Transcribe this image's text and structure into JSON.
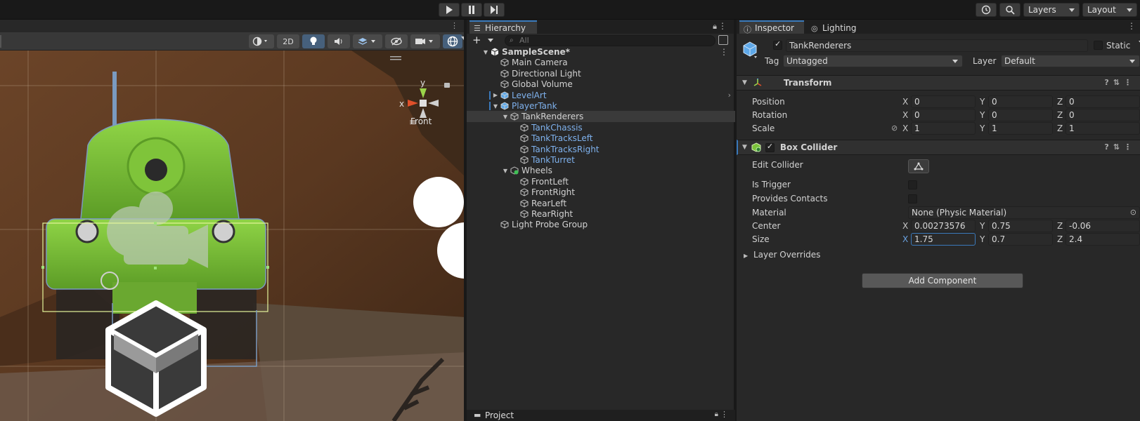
{
  "toolbar": {
    "layers_label": "Layers",
    "layout_label": "Layout"
  },
  "scene": {
    "mode_2d": "2D",
    "view_label": "Front",
    "axis_y": "y",
    "axis_x": "x"
  },
  "hierarchy": {
    "tab_label": "Hierarchy",
    "search_placeholder": "All",
    "items": [
      {
        "label": "SampleScene*",
        "indent": 0,
        "fold": "open",
        "kind": "scene",
        "blue": false,
        "selected": false
      },
      {
        "label": "Main Camera",
        "indent": 1,
        "fold": "none",
        "kind": "cube",
        "blue": false,
        "selected": false
      },
      {
        "label": "Directional Light",
        "indent": 1,
        "fold": "none",
        "kind": "cube",
        "blue": false,
        "selected": false
      },
      {
        "label": "Global Volume",
        "indent": 1,
        "fold": "none",
        "kind": "cube",
        "blue": false,
        "selected": false
      },
      {
        "label": "LevelArt",
        "indent": 1,
        "fold": "closed",
        "kind": "prefab",
        "blue": true,
        "selected": false
      },
      {
        "label": "PlayerTank",
        "indent": 1,
        "fold": "open",
        "kind": "prefab",
        "blue": true,
        "selected": false
      },
      {
        "label": "TankRenderers",
        "indent": 2,
        "fold": "open",
        "kind": "cube",
        "blue": false,
        "selected": true
      },
      {
        "label": "TankChassis",
        "indent": 3,
        "fold": "none",
        "kind": "cube",
        "blue": true,
        "selected": false
      },
      {
        "label": "TankTracksLeft",
        "indent": 3,
        "fold": "none",
        "kind": "cube",
        "blue": true,
        "selected": false
      },
      {
        "label": "TankTracksRight",
        "indent": 3,
        "fold": "none",
        "kind": "cube",
        "blue": true,
        "selected": false
      },
      {
        "label": "TankTurret",
        "indent": 3,
        "fold": "none",
        "kind": "cube",
        "blue": true,
        "selected": false
      },
      {
        "label": "Wheels",
        "indent": 2,
        "fold": "open",
        "kind": "gear",
        "blue": false,
        "selected": false
      },
      {
        "label": "FrontLeft",
        "indent": 3,
        "fold": "none",
        "kind": "cube",
        "blue": false,
        "selected": false
      },
      {
        "label": "FrontRight",
        "indent": 3,
        "fold": "none",
        "kind": "cube",
        "blue": false,
        "selected": false
      },
      {
        "label": "RearLeft",
        "indent": 3,
        "fold": "none",
        "kind": "cube",
        "blue": false,
        "selected": false
      },
      {
        "label": "RearRight",
        "indent": 3,
        "fold": "none",
        "kind": "cube",
        "blue": false,
        "selected": false
      },
      {
        "label": "Light Probe Group",
        "indent": 1,
        "fold": "none",
        "kind": "cube",
        "blue": false,
        "selected": false
      }
    ]
  },
  "project": {
    "tab_label": "Project"
  },
  "inspector": {
    "tab_label": "Inspector",
    "lighting_tab_label": "Lighting",
    "object_name": "TankRenderers",
    "static_label": "Static",
    "tag_label": "Tag",
    "tag_value": "Untagged",
    "layer_label": "Layer",
    "layer_value": "Default",
    "transform": {
      "title": "Transform",
      "position_label": "Position",
      "rotation_label": "Rotation",
      "scale_label": "Scale",
      "position": {
        "x": "0",
        "y": "0",
        "z": "0"
      },
      "rotation": {
        "x": "0",
        "y": "0",
        "z": "0"
      },
      "scale": {
        "x": "1",
        "y": "1",
        "z": "1"
      }
    },
    "box_collider": {
      "title": "Box Collider",
      "edit_collider_label": "Edit Collider",
      "is_trigger_label": "Is Trigger",
      "provides_contacts_label": "Provides Contacts",
      "material_label": "Material",
      "material_value": "None (Physic Material)",
      "center_label": "Center",
      "size_label": "Size",
      "layer_overrides_label": "Layer Overrides",
      "center": {
        "x": "0.00273576",
        "y": "0.75",
        "z": "-0.06"
      },
      "size": {
        "x": "1.75",
        "y": "0.7",
        "z": "2.4"
      }
    },
    "add_component_label": "Add Component",
    "axis": {
      "x": "X",
      "y": "Y",
      "z": "Z"
    }
  },
  "colors": {
    "accent": "#3a79bb",
    "prefab_blue": "#7fb2ee",
    "tank_green": "#7bc23a"
  }
}
